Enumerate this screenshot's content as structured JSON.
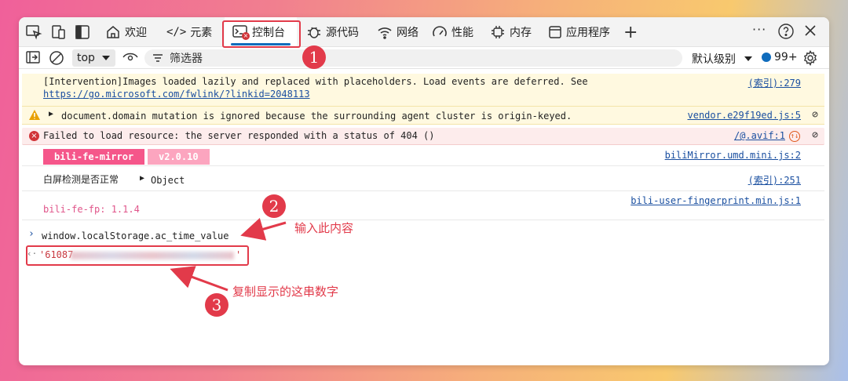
{
  "tabs": {
    "welcome": "欢迎",
    "elements": "元素",
    "console": "控制台",
    "sources": "源代码",
    "network": "网络",
    "performance": "性能",
    "memory": "内存",
    "application": "应用程序"
  },
  "toolbar": {
    "context": "top",
    "filter_placeholder": "筛选器",
    "level": "默认级别",
    "issue_count": "99+"
  },
  "messages": {
    "m1_text_a": "[Intervention]Images loaded lazily and replaced with placeholders. Load events are deferred. See",
    "m1_link": "https://go.microsoft.com/fwlink/?linkid=2048113",
    "m1_src": "(索引):279",
    "m2_text": "document.domain mutation is ignored because the surrounding agent cluster is origin-keyed.",
    "m2_src": "vendor.e29f19ed.js:5",
    "m3_text": "Failed to load resource: the server responded with a status of 404 ()",
    "m3_src": "/@.avif:1",
    "m4_badge_name": "bili-fe-mirror",
    "m4_badge_ver": "v2.0.10",
    "m4_src": "biliMirror.umd.mini.js:2",
    "m5_text": "白屏检测是否正常",
    "m5_obj": "Object",
    "m5_src": "(索引):251",
    "m6_text": "bili-fe-fp: 1.1.4",
    "m6_src": "bili-user-fingerprint.min.js:1",
    "input": "window.localStorage.ac_time_value",
    "result": "'61087"
  },
  "annotations": {
    "n1": "1",
    "n2": "2",
    "n3": "3",
    "a2": "输入此内容",
    "a3": "复制显示的这串数字"
  },
  "colors": {
    "accent": "#0f6cbd",
    "annotation": "#e23a4a",
    "badge_name_bg": "#f5568a",
    "badge_ver_bg": "#fca5bf"
  }
}
